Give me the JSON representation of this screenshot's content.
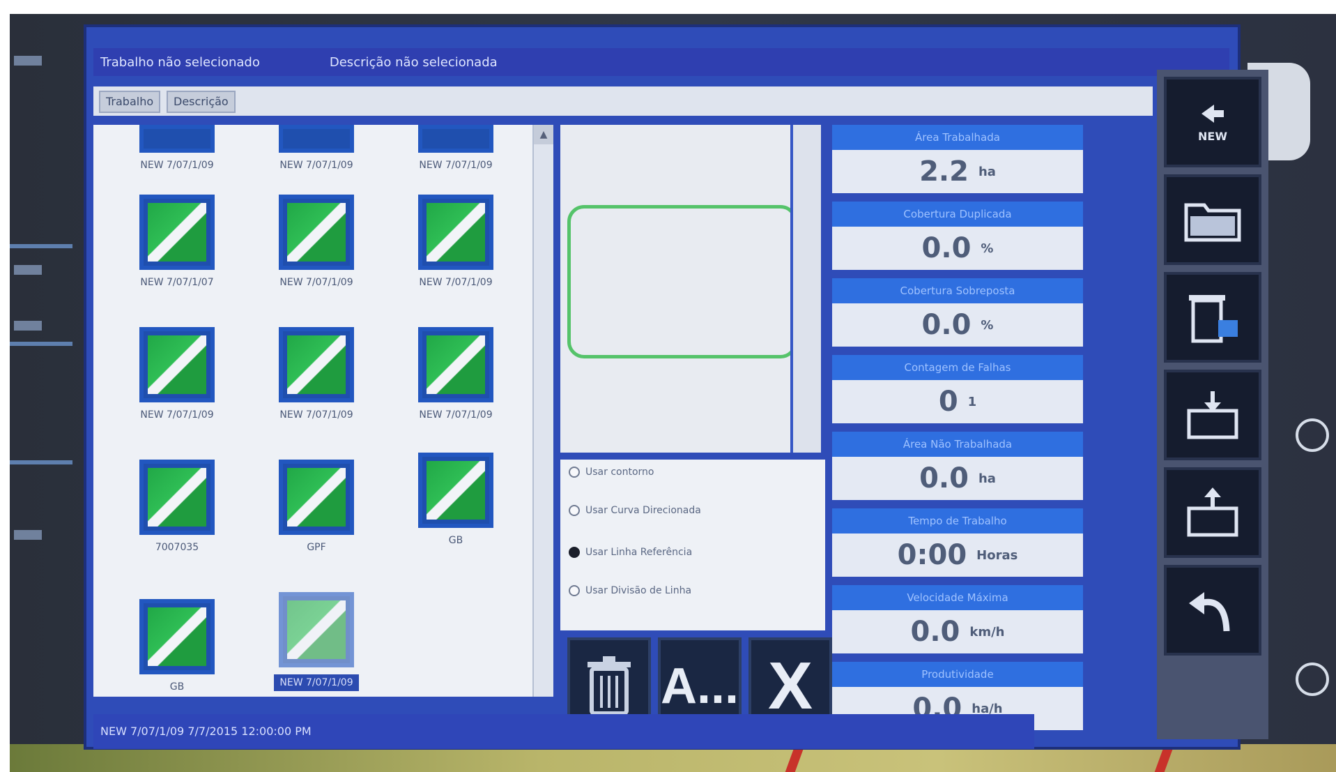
{
  "window": {
    "title_left": "Trabalho não selecionado",
    "title_right": "Descrição não selecionada"
  },
  "toolbar": {
    "tabs": [
      "Trabalho",
      "Descrição"
    ]
  },
  "files": [
    {
      "label": "NEW 7/07/1/09"
    },
    {
      "label": "NEW 7/07/1/09"
    },
    {
      "label": "NEW 7/07/1/09"
    },
    {
      "label": "NEW 7/07/1/07"
    },
    {
      "label": "NEW 7/07/1/09"
    },
    {
      "label": "NEW 7/07/1/09"
    },
    {
      "label": "NEW 7/07/1/09"
    },
    {
      "label": "NEW 7/07/1/09"
    },
    {
      "label": "NEW 7/07/1/09"
    },
    {
      "label": "7007035"
    },
    {
      "label": "GPF"
    },
    {
      "label": "GB"
    },
    {
      "label": "GB"
    },
    {
      "label": "NEW 7/07/1/09"
    }
  ],
  "options": [
    {
      "label": "Usar contorno",
      "checked": false
    },
    {
      "label": "Usar Curva Direcionada",
      "checked": false
    },
    {
      "label": "Usar Linha Referência",
      "checked": true
    },
    {
      "label": "Usar Divisão de Linha",
      "checked": false
    }
  ],
  "actions": {
    "delete_icon": "trash-icon",
    "rename_label": "A...",
    "close_label": "X"
  },
  "stats": [
    {
      "label": "Área Trabalhada",
      "value": "2.2",
      "unit": "ha"
    },
    {
      "label": "Cobertura Duplicada",
      "value": "0.0",
      "unit": "%"
    },
    {
      "label": "Cobertura Sobreposta",
      "value": "0.0",
      "unit": "%"
    },
    {
      "label": "Contagem de Falhas",
      "value": "0",
      "unit": "1"
    },
    {
      "label": "Área Não Trabalhada",
      "value": "0.0",
      "unit": "ha"
    },
    {
      "label": "Tempo de Trabalho",
      "value": "0:00",
      "unit": "Horas"
    },
    {
      "label": "Velocidade Máxima",
      "value": "0.0",
      "unit": "km/h"
    },
    {
      "label": "Produtividade",
      "value": "0.0",
      "unit": "ha/h"
    }
  ],
  "side_buttons": [
    {
      "icon": "back-arrow-icon",
      "label": "NEW"
    },
    {
      "icon": "folder-icon",
      "label": ""
    },
    {
      "icon": "delete-bin-icon",
      "label": ""
    },
    {
      "icon": "import-icon",
      "label": ""
    },
    {
      "icon": "export-icon",
      "label": ""
    },
    {
      "icon": "undo-icon",
      "label": ""
    }
  ],
  "status_bar": "NEW 7/07/1/09  7/7/2015 12:00:00 PM"
}
